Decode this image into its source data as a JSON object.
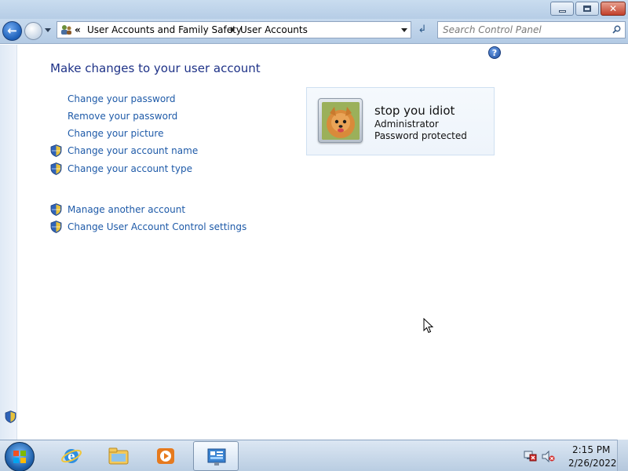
{
  "window": {
    "minimize_icon": "minimize-icon",
    "maximize_icon": "restore-icon",
    "close_label": "✕"
  },
  "navigation": {
    "back_icon": "back-arrow-icon",
    "forward_icon": "forward-arrow-icon",
    "refresh_label": "↲",
    "breadcrumb_overflow": "«",
    "breadcrumbs": [
      "User Accounts and Family Safety",
      "User Accounts"
    ],
    "search_placeholder": "Search Control Panel"
  },
  "main": {
    "help_label": "?",
    "title": "Make changes to your user account",
    "tasks": [
      {
        "label": "Change your password",
        "shield": false
      },
      {
        "label": "Remove your password",
        "shield": false
      },
      {
        "label": "Change your picture",
        "shield": false
      },
      {
        "label": "Change your account name",
        "shield": true
      },
      {
        "label": "Change your account type",
        "shield": true
      }
    ],
    "other_tasks": [
      {
        "label": "Manage another account",
        "shield": true
      },
      {
        "label": "Change User Account Control settings",
        "shield": true
      }
    ]
  },
  "account": {
    "name": "stop you idiot",
    "type": "Administrator",
    "status": "Password protected",
    "picture_icon": "dog-avatar-icon"
  },
  "taskbar": {
    "items": [
      "start-orb-icon",
      "internet-explorer-icon",
      "windows-explorer-icon",
      "media-player-icon",
      "control-panel-icon"
    ],
    "tray": [
      "network-icon",
      "volume-muted-icon"
    ],
    "time": "2:15 PM",
    "date": "2/26/2022"
  },
  "colors": {
    "link": "#1e5aa8",
    "title": "#1e3287",
    "chrome": "#b9cde2"
  }
}
